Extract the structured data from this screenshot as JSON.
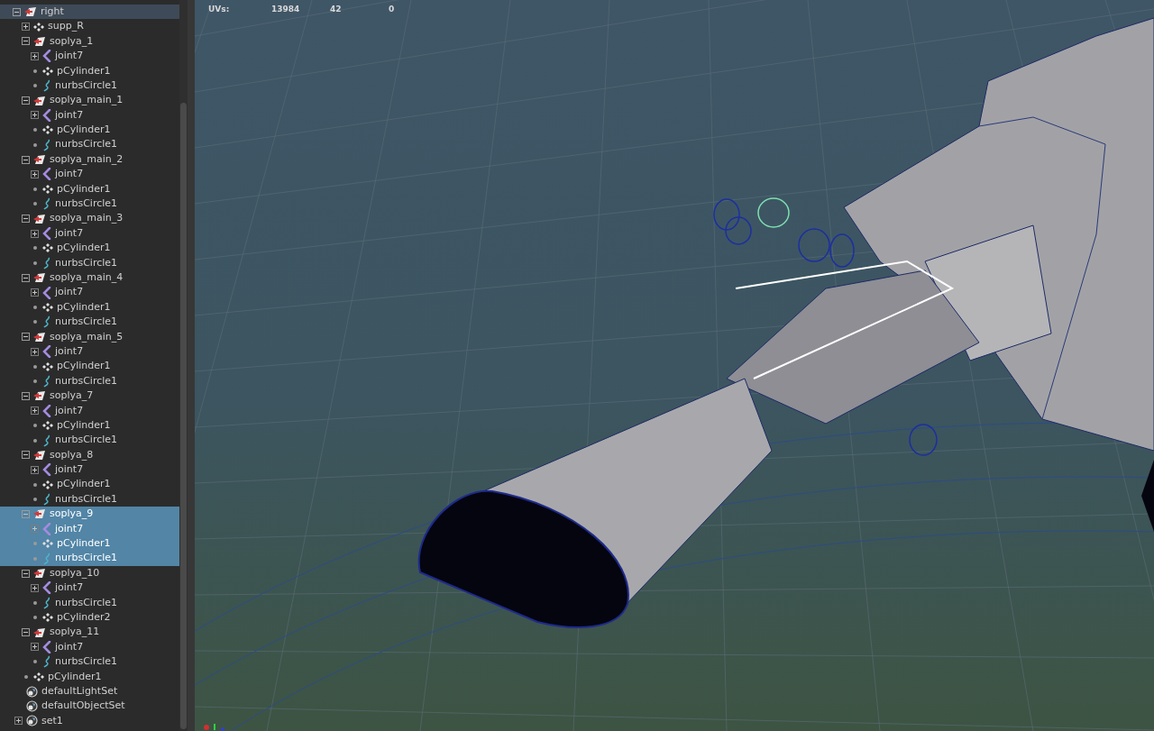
{
  "outliner": {
    "root": {
      "label": "right",
      "kind": "group",
      "has_toggle": true,
      "expanded": true,
      "highlighted": true,
      "children": [
        {
          "label": "supp_R",
          "kind": "mesh",
          "has_toggle": true,
          "expanded": false,
          "selected": false
        },
        {
          "label": "soplya_1",
          "kind": "group",
          "has_toggle": true,
          "expanded": true,
          "selected": false,
          "children": [
            {
              "label": "joint7",
              "kind": "joint",
              "has_toggle": true,
              "expanded": false,
              "selected": false
            },
            {
              "label": "pCylinder1",
              "kind": "mesh",
              "has_toggle": false,
              "selected": false
            },
            {
              "label": "nurbsCircle1",
              "kind": "curve",
              "has_toggle": false,
              "selected": false
            }
          ]
        },
        {
          "label": "soplya_main_1",
          "kind": "group",
          "has_toggle": true,
          "expanded": true,
          "selected": false,
          "children": [
            {
              "label": "joint7",
              "kind": "joint",
              "has_toggle": true,
              "expanded": false,
              "selected": false
            },
            {
              "label": "pCylinder1",
              "kind": "mesh",
              "has_toggle": false,
              "selected": false
            },
            {
              "label": "nurbsCircle1",
              "kind": "curve",
              "has_toggle": false,
              "selected": false
            }
          ]
        },
        {
          "label": "soplya_main_2",
          "kind": "group",
          "has_toggle": true,
          "expanded": true,
          "selected": false,
          "children": [
            {
              "label": "joint7",
              "kind": "joint",
              "has_toggle": true,
              "expanded": false,
              "selected": false
            },
            {
              "label": "pCylinder1",
              "kind": "mesh",
              "has_toggle": false,
              "selected": false
            },
            {
              "label": "nurbsCircle1",
              "kind": "curve",
              "has_toggle": false,
              "selected": false
            }
          ]
        },
        {
          "label": "soplya_main_3",
          "kind": "group",
          "has_toggle": true,
          "expanded": true,
          "selected": false,
          "children": [
            {
              "label": "joint7",
              "kind": "joint",
              "has_toggle": true,
              "expanded": false,
              "selected": false
            },
            {
              "label": "pCylinder1",
              "kind": "mesh",
              "has_toggle": false,
              "selected": false
            },
            {
              "label": "nurbsCircle1",
              "kind": "curve",
              "has_toggle": false,
              "selected": false
            }
          ]
        },
        {
          "label": "soplya_main_4",
          "kind": "group",
          "has_toggle": true,
          "expanded": true,
          "selected": false,
          "children": [
            {
              "label": "joint7",
              "kind": "joint",
              "has_toggle": true,
              "expanded": false,
              "selected": false
            },
            {
              "label": "pCylinder1",
              "kind": "mesh",
              "has_toggle": false,
              "selected": false
            },
            {
              "label": "nurbsCircle1",
              "kind": "curve",
              "has_toggle": false,
              "selected": false
            }
          ]
        },
        {
          "label": "soplya_main_5",
          "kind": "group",
          "has_toggle": true,
          "expanded": true,
          "selected": false,
          "children": [
            {
              "label": "joint7",
              "kind": "joint",
              "has_toggle": true,
              "expanded": false,
              "selected": false
            },
            {
              "label": "pCylinder1",
              "kind": "mesh",
              "has_toggle": false,
              "selected": false
            },
            {
              "label": "nurbsCircle1",
              "kind": "curve",
              "has_toggle": false,
              "selected": false
            }
          ]
        },
        {
          "label": "soplya_7",
          "kind": "group",
          "has_toggle": true,
          "expanded": true,
          "selected": false,
          "children": [
            {
              "label": "joint7",
              "kind": "joint",
              "has_toggle": true,
              "expanded": false,
              "selected": false
            },
            {
              "label": "pCylinder1",
              "kind": "mesh",
              "has_toggle": false,
              "selected": false
            },
            {
              "label": "nurbsCircle1",
              "kind": "curve",
              "has_toggle": false,
              "selected": false
            }
          ]
        },
        {
          "label": "soplya_8",
          "kind": "group",
          "has_toggle": true,
          "expanded": true,
          "selected": false,
          "children": [
            {
              "label": "joint7",
              "kind": "joint",
              "has_toggle": true,
              "expanded": false,
              "selected": false
            },
            {
              "label": "pCylinder1",
              "kind": "mesh",
              "has_toggle": false,
              "selected": false
            },
            {
              "label": "nurbsCircle1",
              "kind": "curve",
              "has_toggle": false,
              "selected": false
            }
          ]
        },
        {
          "label": "soplya_9",
          "kind": "group",
          "has_toggle": true,
          "expanded": true,
          "selected": true,
          "children": [
            {
              "label": "joint7",
              "kind": "joint",
              "has_toggle": true,
              "expanded": false,
              "selected": true
            },
            {
              "label": "pCylinder1",
              "kind": "mesh",
              "has_toggle": false,
              "selected": true
            },
            {
              "label": "nurbsCircle1",
              "kind": "curve",
              "has_toggle": false,
              "selected": true
            }
          ]
        },
        {
          "label": "soplya_10",
          "kind": "group",
          "has_toggle": true,
          "expanded": true,
          "selected": false,
          "children": [
            {
              "label": "joint7",
              "kind": "joint",
              "has_toggle": true,
              "expanded": false,
              "selected": false
            },
            {
              "label": "nurbsCircle1",
              "kind": "curve",
              "has_toggle": false,
              "selected": false
            },
            {
              "label": "pCylinder2",
              "kind": "mesh",
              "has_toggle": false,
              "selected": false
            }
          ]
        },
        {
          "label": "soplya_11",
          "kind": "group",
          "has_toggle": true,
          "expanded": true,
          "selected": false,
          "children": [
            {
              "label": "joint7",
              "kind": "joint",
              "has_toggle": true,
              "expanded": false,
              "selected": false
            },
            {
              "label": "nurbsCircle1",
              "kind": "curve",
              "has_toggle": false,
              "selected": false
            }
          ]
        },
        {
          "label": "pCylinder1",
          "kind": "mesh",
          "has_toggle": false,
          "selected": false
        }
      ]
    },
    "sets": [
      {
        "label": "defaultLightSet",
        "has_toggle": false
      },
      {
        "label": "defaultObjectSet",
        "has_toggle": false
      },
      {
        "label": "set1",
        "has_toggle": true,
        "expanded": false
      }
    ]
  },
  "viewport": {
    "hud": {
      "label": "UVs:",
      "values": [
        "13984",
        "42",
        "0"
      ]
    }
  }
}
